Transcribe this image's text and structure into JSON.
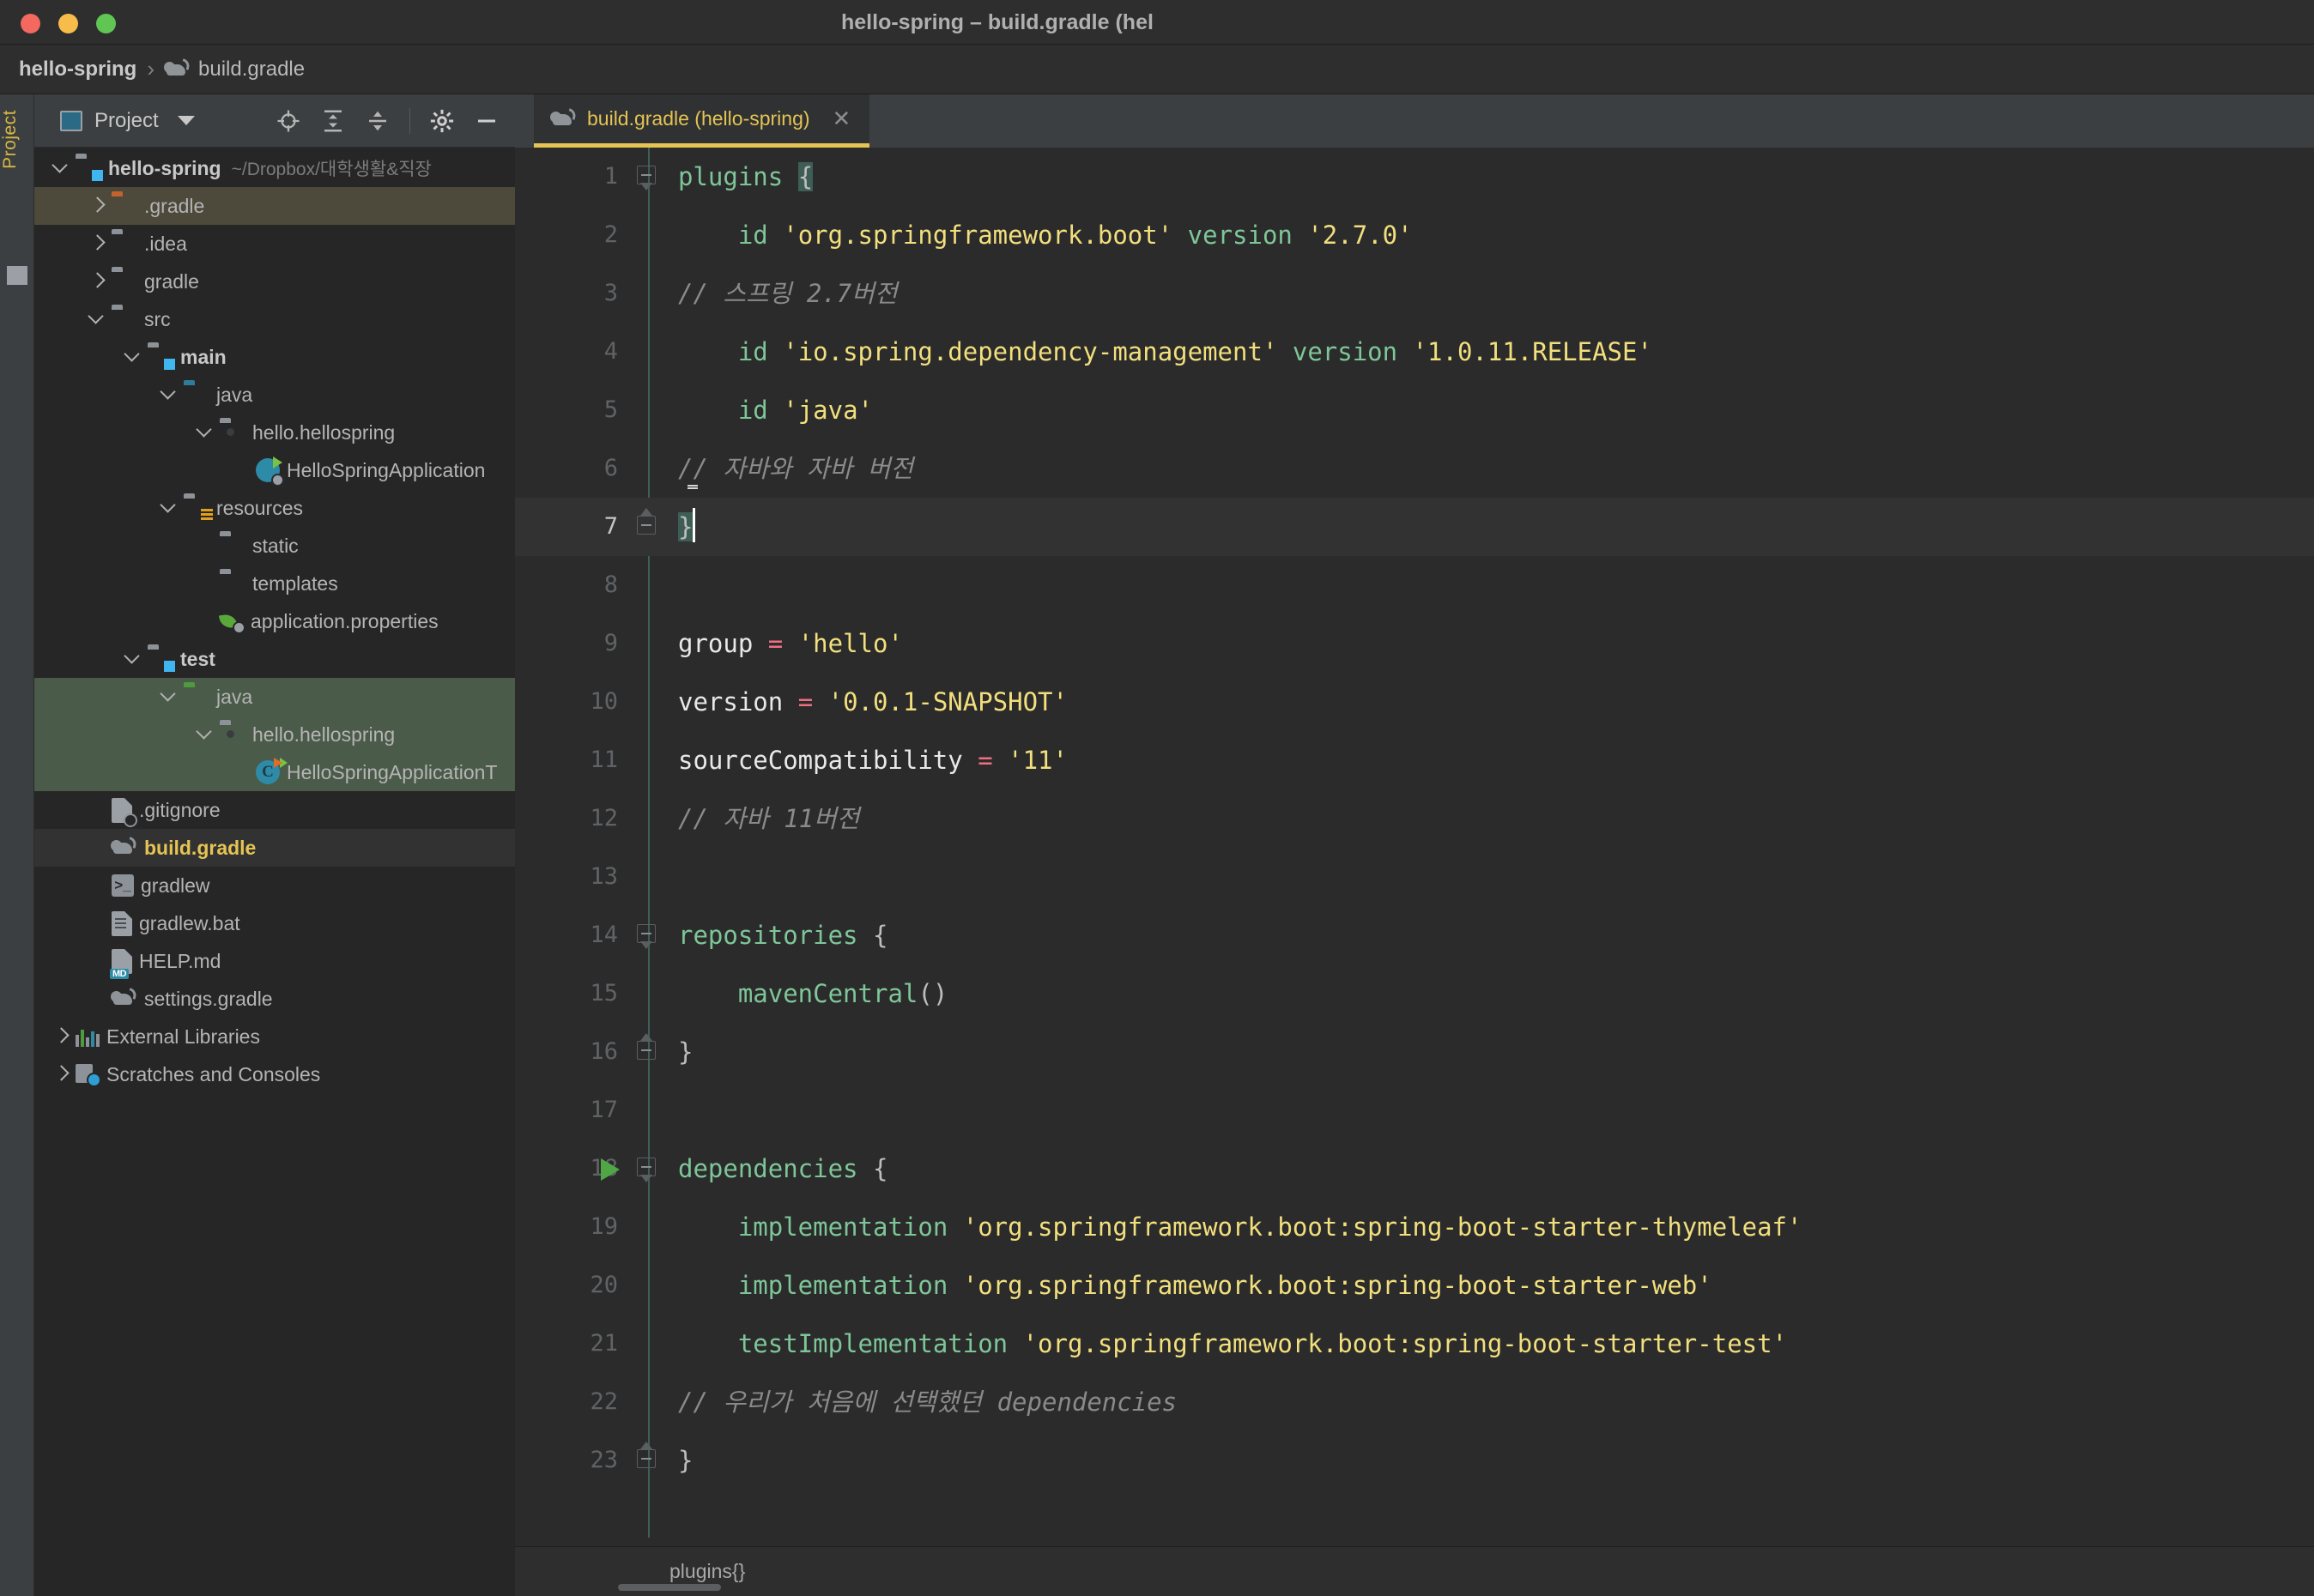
{
  "window": {
    "title": "hello-spring – build.gradle (hel",
    "traffic_lights": [
      "close-red",
      "minimize-yellow",
      "zoom-green"
    ]
  },
  "navbar": {
    "project": "hello-spring",
    "separator": "›",
    "file": "build.gradle",
    "file_icon": "gradle-elephant-icon"
  },
  "toolstrip": {
    "label": "Project"
  },
  "panel": {
    "header_title": "Project",
    "header_icon": "project-view-icon",
    "caret_icon": "chevron-down-icon",
    "actions": [
      "locate-in-tree-icon",
      "expand-all-icon",
      "collapse-all-icon",
      "settings-gear-icon",
      "hide-panel-icon"
    ]
  },
  "tree": [
    {
      "label": "hello-spring",
      "path": "~/Dropbox/대학생활&직장",
      "indent": 0,
      "arrow": "down",
      "icon": "module-folder",
      "style": "bold",
      "row": "normal"
    },
    {
      "label": ".gradle",
      "indent": 1,
      "arrow": "right",
      "icon": "folder-orange",
      "style": "",
      "row": "sel-olive"
    },
    {
      "label": ".idea",
      "indent": 1,
      "arrow": "right",
      "icon": "folder-gray",
      "style": "",
      "row": "normal"
    },
    {
      "label": "gradle",
      "indent": 1,
      "arrow": "right",
      "icon": "folder-gray",
      "style": "",
      "row": "normal"
    },
    {
      "label": "src",
      "indent": 1,
      "arrow": "down",
      "icon": "folder-gray",
      "style": "",
      "row": "normal"
    },
    {
      "label": "main",
      "indent": 2,
      "arrow": "down",
      "icon": "module-folder",
      "style": "bold",
      "row": "normal"
    },
    {
      "label": "java",
      "indent": 3,
      "arrow": "down",
      "icon": "folder-teal",
      "style": "",
      "row": "normal"
    },
    {
      "label": "hello.hellospring",
      "indent": 4,
      "arrow": "down",
      "icon": "package-folder",
      "style": "",
      "row": "normal"
    },
    {
      "label": "HelloSpringApplication",
      "indent": 5,
      "arrow": "none",
      "icon": "spring-boot-class-icon",
      "style": "",
      "row": "normal"
    },
    {
      "label": "resources",
      "indent": 3,
      "arrow": "down",
      "icon": "resources-folder",
      "style": "",
      "row": "normal"
    },
    {
      "label": "static",
      "indent": 4,
      "arrow": "none",
      "icon": "folder-gray",
      "style": "",
      "row": "normal"
    },
    {
      "label": "templates",
      "indent": 4,
      "arrow": "none",
      "icon": "folder-gray",
      "style": "",
      "row": "normal"
    },
    {
      "label": "application.properties",
      "indent": 4,
      "arrow": "none",
      "icon": "spring-properties-icon",
      "style": "",
      "row": "normal"
    },
    {
      "label": "test",
      "indent": 2,
      "arrow": "down",
      "icon": "module-folder",
      "style": "bold",
      "row": "normal"
    },
    {
      "label": "java",
      "indent": 3,
      "arrow": "down",
      "icon": "folder-green",
      "style": "",
      "row": "sel-green"
    },
    {
      "label": "hello.hellospring",
      "indent": 4,
      "arrow": "down",
      "icon": "package-folder",
      "style": "",
      "row": "sel-green"
    },
    {
      "label": "HelloSpringApplicationT",
      "indent": 5,
      "arrow": "none",
      "icon": "test-class-icon",
      "style": "",
      "row": "sel-green"
    },
    {
      "label": ".gitignore",
      "indent": 1,
      "arrow": "none",
      "icon": "gitignore-file-icon",
      "style": "",
      "row": "normal"
    },
    {
      "label": "build.gradle",
      "indent": 1,
      "arrow": "none",
      "icon": "gradle-elephant-icon",
      "style": "yellow",
      "row": "sel-dark"
    },
    {
      "label": "gradlew",
      "indent": 1,
      "arrow": "none",
      "icon": "shell-script-icon",
      "style": "",
      "row": "normal"
    },
    {
      "label": "gradlew.bat",
      "indent": 1,
      "arrow": "none",
      "icon": "bat-file-icon",
      "style": "",
      "row": "normal"
    },
    {
      "label": "HELP.md",
      "indent": 1,
      "arrow": "none",
      "icon": "markdown-file-icon",
      "style": "",
      "row": "normal"
    },
    {
      "label": "settings.gradle",
      "indent": 1,
      "arrow": "none",
      "icon": "gradle-elephant-icon",
      "style": "",
      "row": "normal"
    },
    {
      "label": "External Libraries",
      "indent": 0,
      "arrow": "right",
      "icon": "libraries-icon",
      "style": "",
      "row": "normal"
    },
    {
      "label": "Scratches and Consoles",
      "indent": 0,
      "arrow": "right",
      "icon": "scratches-icon",
      "style": "",
      "row": "normal"
    }
  ],
  "editor": {
    "tab": {
      "title": "build.gradle (hello-spring)",
      "icon": "gradle-elephant-icon",
      "close_icon": "close-icon"
    },
    "lines": [
      {
        "n": "1",
        "fold": "down",
        "tokens": [
          {
            "t": "plugins",
            "c": "gn"
          },
          {
            "t": " ",
            "c": "punc"
          },
          {
            "t": "{",
            "c": "punc brace-hl"
          }
        ]
      },
      {
        "n": "2",
        "tokens": [
          {
            "t": "    ",
            "c": "punc"
          },
          {
            "t": "id",
            "c": "gn"
          },
          {
            "t": " ",
            "c": "punc"
          },
          {
            "t": "'org.springframework.boot'",
            "c": "str"
          },
          {
            "t": " ",
            "c": "punc"
          },
          {
            "t": "version",
            "c": "gn"
          },
          {
            "t": " ",
            "c": "punc"
          },
          {
            "t": "'2.7.0'",
            "c": "str"
          }
        ]
      },
      {
        "n": "3",
        "tokens": [
          {
            "t": "// 스프링 2.7버전",
            "c": "cmt"
          }
        ]
      },
      {
        "n": "4",
        "tokens": [
          {
            "t": "    ",
            "c": "punc"
          },
          {
            "t": "id",
            "c": "gn"
          },
          {
            "t": " ",
            "c": "punc"
          },
          {
            "t": "'io.spring.dependency-management'",
            "c": "str"
          },
          {
            "t": " ",
            "c": "punc"
          },
          {
            "t": "version",
            "c": "gn"
          },
          {
            "t": " ",
            "c": "punc"
          },
          {
            "t": "'1.0.11.RELEASE'",
            "c": "str"
          }
        ]
      },
      {
        "n": "5",
        "tokens": [
          {
            "t": "    ",
            "c": "punc"
          },
          {
            "t": "id",
            "c": "gn"
          },
          {
            "t": " ",
            "c": "punc"
          },
          {
            "t": "'java'",
            "c": "str"
          }
        ]
      },
      {
        "n": "6",
        "bulb": true,
        "tokens": [
          {
            "t": "// 자바와 자바 버전",
            "c": "cmt"
          }
        ]
      },
      {
        "n": "7",
        "current": true,
        "fold": "up",
        "caret": true,
        "tokens": [
          {
            "t": "}",
            "c": "punc brace-hl"
          }
        ]
      },
      {
        "n": "8",
        "tokens": []
      },
      {
        "n": "9",
        "tokens": [
          {
            "t": "group",
            "c": "id"
          },
          {
            "t": " ",
            "c": "punc"
          },
          {
            "t": "=",
            "c": "op"
          },
          {
            "t": " ",
            "c": "punc"
          },
          {
            "t": "'hello'",
            "c": "str"
          }
        ]
      },
      {
        "n": "10",
        "tokens": [
          {
            "t": "version",
            "c": "id"
          },
          {
            "t": " ",
            "c": "punc"
          },
          {
            "t": "=",
            "c": "op"
          },
          {
            "t": " ",
            "c": "punc"
          },
          {
            "t": "'0.0.1-SNAPSHOT'",
            "c": "str"
          }
        ]
      },
      {
        "n": "11",
        "tokens": [
          {
            "t": "sourceCompatibility",
            "c": "id"
          },
          {
            "t": " ",
            "c": "punc"
          },
          {
            "t": "=",
            "c": "op"
          },
          {
            "t": " ",
            "c": "punc"
          },
          {
            "t": "'11'",
            "c": "str"
          }
        ]
      },
      {
        "n": "12",
        "tokens": [
          {
            "t": "// 자바 11버전",
            "c": "cmt"
          }
        ]
      },
      {
        "n": "13",
        "tokens": []
      },
      {
        "n": "14",
        "fold": "down",
        "tokens": [
          {
            "t": "repositories",
            "c": "gn"
          },
          {
            "t": " {",
            "c": "punc"
          }
        ]
      },
      {
        "n": "15",
        "tokens": [
          {
            "t": "    ",
            "c": "punc"
          },
          {
            "t": "mavenCentral",
            "c": "gn"
          },
          {
            "t": "()",
            "c": "punc"
          }
        ]
      },
      {
        "n": "16",
        "fold": "up",
        "tokens": [
          {
            "t": "}",
            "c": "punc"
          }
        ]
      },
      {
        "n": "17",
        "tokens": []
      },
      {
        "n": "18",
        "run": true,
        "fold": "down",
        "tokens": [
          {
            "t": "dependencies",
            "c": "gn"
          },
          {
            "t": " {",
            "c": "punc"
          }
        ]
      },
      {
        "n": "19",
        "tokens": [
          {
            "t": "    ",
            "c": "punc"
          },
          {
            "t": "implementation",
            "c": "gn"
          },
          {
            "t": " ",
            "c": "punc"
          },
          {
            "t": "'org.springframework.boot:spring-boot-starter-thymeleaf'",
            "c": "str"
          }
        ]
      },
      {
        "n": "20",
        "tokens": [
          {
            "t": "    ",
            "c": "punc"
          },
          {
            "t": "implementation",
            "c": "gn"
          },
          {
            "t": " ",
            "c": "punc"
          },
          {
            "t": "'org.springframework.boot:spring-boot-starter-web'",
            "c": "str"
          }
        ]
      },
      {
        "n": "21",
        "tokens": [
          {
            "t": "    ",
            "c": "punc"
          },
          {
            "t": "testImplementation",
            "c": "gn"
          },
          {
            "t": " ",
            "c": "punc"
          },
          {
            "t": "'org.springframework.boot:spring-boot-starter-test'",
            "c": "str"
          }
        ]
      },
      {
        "n": "22",
        "tokens": [
          {
            "t": "// 우리가 처음에 선택했던 ",
            "c": "cmt"
          },
          {
            "t": "dependencies",
            "c": "cmt"
          }
        ]
      },
      {
        "n": "23",
        "fold": "up",
        "tokens": [
          {
            "t": "}",
            "c": "punc"
          }
        ]
      }
    ]
  },
  "statusbar": {
    "breadcrumb": "plugins{}"
  }
}
